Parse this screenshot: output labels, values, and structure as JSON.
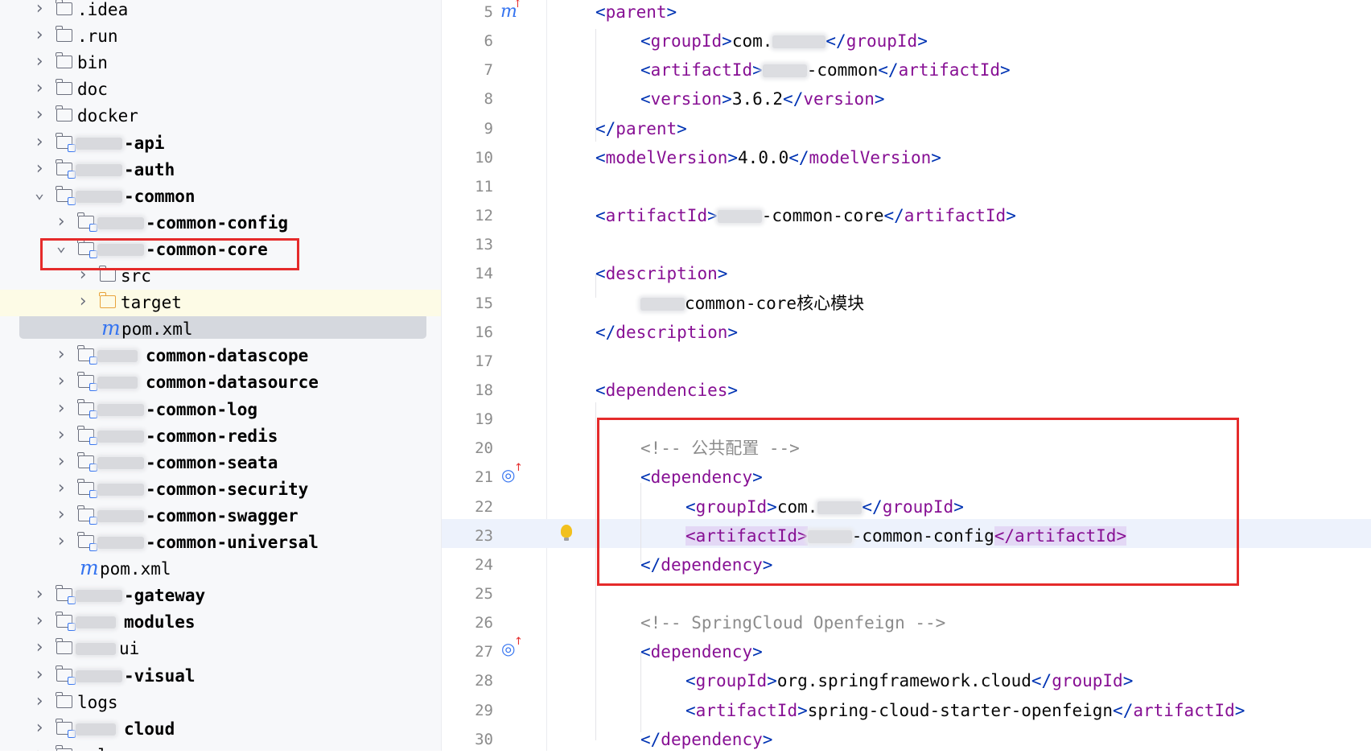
{
  "tree": {
    "items": [
      {
        "label": ".idea",
        "depth": 0,
        "expanded": false,
        "type": "folder"
      },
      {
        "label": ".run",
        "depth": 0,
        "expanded": false,
        "type": "folder"
      },
      {
        "label": "bin",
        "depth": 0,
        "expanded": false,
        "type": "folder"
      },
      {
        "label": "doc",
        "depth": 0,
        "expanded": false,
        "type": "folder"
      },
      {
        "label": "docker",
        "depth": 0,
        "expanded": false,
        "type": "folder"
      },
      {
        "label": "-api",
        "depth": 0,
        "expanded": false,
        "type": "module"
      },
      {
        "label": "-auth",
        "depth": 0,
        "expanded": false,
        "type": "module"
      },
      {
        "label": "-common",
        "depth": 0,
        "expanded": true,
        "type": "module"
      },
      {
        "label": "-common-config",
        "depth": 1,
        "expanded": false,
        "type": "module"
      },
      {
        "label": "-common-core",
        "depth": 1,
        "expanded": true,
        "type": "module"
      },
      {
        "label": "src",
        "depth": 2,
        "expanded": false,
        "type": "folder"
      },
      {
        "label": "target",
        "depth": 2,
        "expanded": false,
        "type": "target"
      },
      {
        "label": "pom.xml",
        "depth": 2,
        "type": "maven",
        "selected": true
      },
      {
        "label": "common-datascope",
        "depth": 1,
        "expanded": false,
        "type": "module"
      },
      {
        "label": "common-datasource",
        "depth": 1,
        "expanded": false,
        "type": "module"
      },
      {
        "label": "-common-log",
        "depth": 1,
        "expanded": false,
        "type": "module"
      },
      {
        "label": "-common-redis",
        "depth": 1,
        "expanded": false,
        "type": "module"
      },
      {
        "label": "-common-seata",
        "depth": 1,
        "expanded": false,
        "type": "module"
      },
      {
        "label": "-common-security",
        "depth": 1,
        "expanded": false,
        "type": "module"
      },
      {
        "label": "-common-swagger",
        "depth": 1,
        "expanded": false,
        "type": "module"
      },
      {
        "label": "-common-universal",
        "depth": 1,
        "expanded": false,
        "type": "module"
      },
      {
        "label": "pom.xml",
        "depth": 1,
        "type": "maven"
      },
      {
        "label": "-gateway",
        "depth": 0,
        "expanded": false,
        "type": "module"
      },
      {
        "label": "modules",
        "depth": 0,
        "expanded": false,
        "type": "module"
      },
      {
        "label": "ui",
        "depth": 0,
        "expanded": false,
        "type": "folder"
      },
      {
        "label": "-visual",
        "depth": 0,
        "expanded": false,
        "type": "module"
      },
      {
        "label": "logs",
        "depth": 0,
        "expanded": false,
        "type": "folder"
      },
      {
        "label": "cloud",
        "depth": 0,
        "expanded": false,
        "type": "module"
      },
      {
        "label": "sql",
        "depth": 0,
        "expanded": false,
        "type": "folder"
      }
    ]
  },
  "editor": {
    "lines": [
      {
        "n": "5",
        "parts": [
          [
            "tag",
            "<"
          ],
          [
            "tname",
            "parent"
          ],
          [
            "tag",
            ">"
          ]
        ],
        "indent": 0
      },
      {
        "n": "6",
        "parts": [
          [
            "tag",
            "<"
          ],
          [
            "tname",
            "groupId"
          ],
          [
            "tag",
            ">"
          ],
          [
            "txt",
            "com."
          ],
          [
            "blur",
            "      "
          ],
          [
            "tag",
            "</"
          ],
          [
            "tname",
            "groupId"
          ],
          [
            "tag",
            ">"
          ]
        ],
        "indent": 1
      },
      {
        "n": "7",
        "parts": [
          [
            "tag",
            "<"
          ],
          [
            "tname",
            "artifactId"
          ],
          [
            "tag",
            ">"
          ],
          [
            "blur",
            "     "
          ],
          [
            "txt",
            "-common"
          ],
          [
            "tag",
            "</"
          ],
          [
            "tname",
            "artifactId"
          ],
          [
            "tag",
            ">"
          ]
        ],
        "indent": 1
      },
      {
        "n": "8",
        "parts": [
          [
            "tag",
            "<"
          ],
          [
            "tname",
            "version"
          ],
          [
            "tag",
            ">"
          ],
          [
            "txt",
            "3.6.2"
          ],
          [
            "tag",
            "</"
          ],
          [
            "tname",
            "version"
          ],
          [
            "tag",
            ">"
          ]
        ],
        "indent": 1
      },
      {
        "n": "9",
        "parts": [
          [
            "tag",
            "</"
          ],
          [
            "tname",
            "parent"
          ],
          [
            "tag",
            ">"
          ]
        ],
        "indent": 0
      },
      {
        "n": "10",
        "parts": [
          [
            "tag",
            "<"
          ],
          [
            "tname",
            "modelVersion"
          ],
          [
            "tag",
            ">"
          ],
          [
            "txt",
            "4.0.0"
          ],
          [
            "tag",
            "</"
          ],
          [
            "tname",
            "modelVersion"
          ],
          [
            "tag",
            ">"
          ]
        ],
        "indent": 0
      },
      {
        "n": "11",
        "parts": [],
        "indent": 0
      },
      {
        "n": "12",
        "parts": [
          [
            "tag",
            "<"
          ],
          [
            "tname",
            "artifactId"
          ],
          [
            "tag",
            ">"
          ],
          [
            "blur",
            "     "
          ],
          [
            "txt",
            "-common-core"
          ],
          [
            "tag",
            "</"
          ],
          [
            "tname",
            "artifactId"
          ],
          [
            "tag",
            ">"
          ]
        ],
        "indent": 0
      },
      {
        "n": "13",
        "parts": [],
        "indent": 0
      },
      {
        "n": "14",
        "parts": [
          [
            "tag",
            "<"
          ],
          [
            "tname",
            "description"
          ],
          [
            "tag",
            ">"
          ]
        ],
        "indent": 0
      },
      {
        "n": "15",
        "parts": [
          [
            "blur",
            "     "
          ],
          [
            "txt",
            "common-core核心模块"
          ]
        ],
        "indent": 1
      },
      {
        "n": "16",
        "parts": [
          [
            "tag",
            "</"
          ],
          [
            "tname",
            "description"
          ],
          [
            "tag",
            ">"
          ]
        ],
        "indent": 0
      },
      {
        "n": "17",
        "parts": [],
        "indent": 0
      },
      {
        "n": "18",
        "parts": [
          [
            "tag",
            "<"
          ],
          [
            "tname",
            "dependencies"
          ],
          [
            "tag",
            ">"
          ]
        ],
        "indent": 0
      },
      {
        "n": "19",
        "parts": [],
        "indent": 0
      },
      {
        "n": "20",
        "parts": [
          [
            "cmt",
            "<!-- 公共配置 -->"
          ]
        ],
        "indent": 1
      },
      {
        "n": "21",
        "parts": [
          [
            "tag",
            "<"
          ],
          [
            "tname",
            "dependency"
          ],
          [
            "tag",
            ">"
          ]
        ],
        "indent": 1
      },
      {
        "n": "22",
        "parts": [
          [
            "tag",
            "<"
          ],
          [
            "tname",
            "groupId"
          ],
          [
            "tag",
            ">"
          ],
          [
            "txt",
            "com."
          ],
          [
            "blur",
            "     "
          ],
          [
            "tag",
            "</"
          ],
          [
            "tname",
            "groupId"
          ],
          [
            "tag",
            ">"
          ]
        ],
        "indent": 2
      },
      {
        "n": "23",
        "parts": [
          [
            "hl",
            "<artifactId>"
          ],
          [
            "blur",
            "     "
          ],
          [
            "txt",
            "-common-config"
          ],
          [
            "hl",
            "</artifactId>"
          ]
        ],
        "indent": 2
      },
      {
        "n": "24",
        "parts": [
          [
            "tag",
            "</"
          ],
          [
            "tname",
            "dependency"
          ],
          [
            "tag",
            ">"
          ]
        ],
        "indent": 1
      },
      {
        "n": "25",
        "parts": [],
        "indent": 0
      },
      {
        "n": "26",
        "parts": [
          [
            "cmt",
            "<!-- SpringCloud Openfeign -->"
          ]
        ],
        "indent": 1
      },
      {
        "n": "27",
        "parts": [
          [
            "tag",
            "<"
          ],
          [
            "tname",
            "dependency"
          ],
          [
            "tag",
            ">"
          ]
        ],
        "indent": 1
      },
      {
        "n": "28",
        "parts": [
          [
            "tag",
            "<"
          ],
          [
            "tname",
            "groupId"
          ],
          [
            "tag",
            ">"
          ],
          [
            "txt",
            "org.springframework.cloud"
          ],
          [
            "tag",
            "</"
          ],
          [
            "tname",
            "groupId"
          ],
          [
            "tag",
            ">"
          ]
        ],
        "indent": 2
      },
      {
        "n": "29",
        "parts": [
          [
            "tag",
            "<"
          ],
          [
            "tname",
            "artifactId"
          ],
          [
            "tag",
            ">"
          ],
          [
            "txt",
            "spring-cloud-starter-openfeign"
          ],
          [
            "tag",
            "</"
          ],
          [
            "tname",
            "artifactId"
          ],
          [
            "tag",
            ">"
          ]
        ],
        "indent": 2
      },
      {
        "n": "30",
        "parts": [
          [
            "tag",
            "</"
          ],
          [
            "tname",
            "dependency"
          ],
          [
            "tag",
            ">"
          ]
        ],
        "indent": 1
      }
    ]
  },
  "icons": {
    "maven": "m",
    "gutter_override": "override-icon",
    "gutter_implement": "implement-icon",
    "bulb": "lightbulb-icon"
  },
  "colors": {
    "tag": "#0033b3",
    "tag_name": "#871094",
    "comment": "#8c8c8c",
    "highlight_box": "#e52b2b",
    "selection": "#d5d8de"
  }
}
